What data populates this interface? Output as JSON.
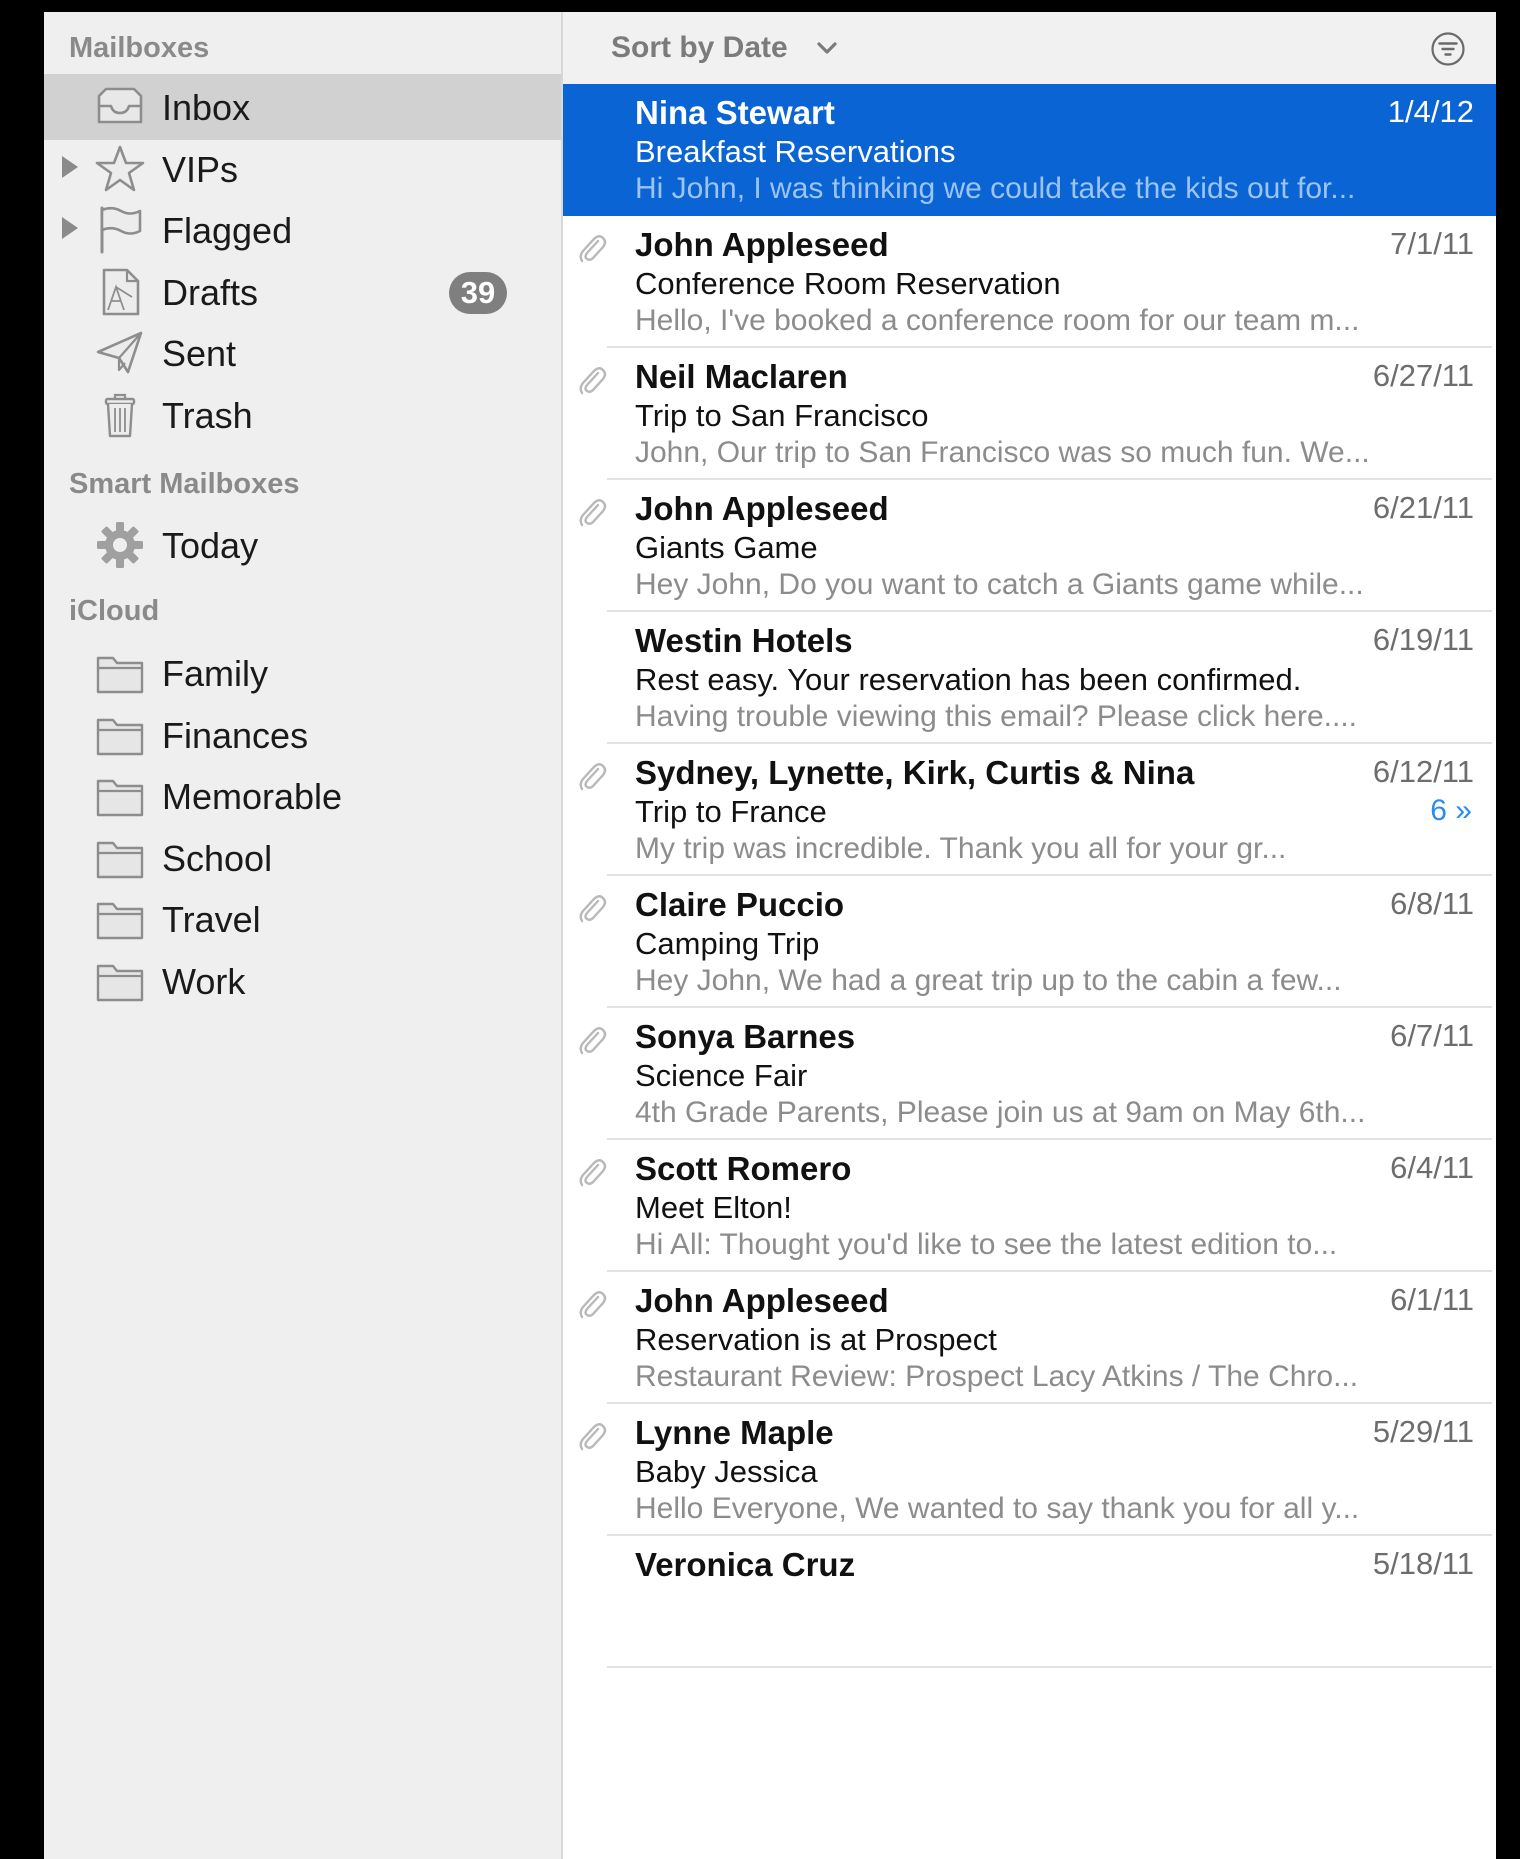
{
  "sidebar": {
    "mailboxes_title": "Mailboxes",
    "mailboxes": [
      {
        "label": "Inbox",
        "icon": "inbox-tray-icon",
        "selected": true
      },
      {
        "label": "VIPs",
        "icon": "star-icon",
        "disclosure": true
      },
      {
        "label": "Flagged",
        "icon": "flag-icon",
        "disclosure": true
      },
      {
        "label": "Drafts",
        "icon": "drafts-page-icon",
        "badge": "39"
      },
      {
        "label": "Sent",
        "icon": "paper-plane-icon"
      },
      {
        "label": "Trash",
        "icon": "trash-can-icon"
      }
    ],
    "smart_title": "Smart Mailboxes",
    "smart": [
      {
        "label": "Today",
        "icon": "gear-icon"
      }
    ],
    "icloud_title": "iCloud",
    "icloud": [
      {
        "label": "Family",
        "icon": "folder-icon"
      },
      {
        "label": "Finances",
        "icon": "folder-icon"
      },
      {
        "label": "Memorable",
        "icon": "folder-icon"
      },
      {
        "label": "School",
        "icon": "folder-icon"
      },
      {
        "label": "Travel",
        "icon": "folder-icon"
      },
      {
        "label": "Work",
        "icon": "folder-icon"
      }
    ]
  },
  "list": {
    "sort_label": "Sort by Date",
    "messages": [
      {
        "sender": "Nina Stewart",
        "date": "1/4/12",
        "subject": "Breakfast Reservations",
        "preview": "Hi John, I was thinking we could take the kids out for...",
        "attachment": false,
        "selected": true
      },
      {
        "sender": "John Appleseed",
        "date": "7/1/11",
        "subject": "Conference Room Reservation",
        "preview": "Hello, I've booked a conference room for our team m...",
        "attachment": true
      },
      {
        "sender": "Neil Maclaren",
        "date": "6/27/11",
        "subject": "Trip to San Francisco",
        "preview": "John, Our trip to San Francisco was so much fun. We...",
        "attachment": true
      },
      {
        "sender": "John Appleseed",
        "date": "6/21/11",
        "subject": "Giants Game",
        "preview": "Hey John, Do you want to catch a Giants game while...",
        "attachment": true
      },
      {
        "sender": "Westin Hotels",
        "date": "6/19/11",
        "subject": "Rest easy. Your reservation has been confirmed.",
        "preview": "Having trouble viewing this email? Please click here....",
        "attachment": false
      },
      {
        "sender": "Sydney, Lynette, Kirk, Curtis & Nina",
        "date": "6/12/11",
        "subject": "Trip to France",
        "preview": "My trip was incredible. Thank you all for your gr...",
        "attachment": true,
        "thread_count": "6 »"
      },
      {
        "sender": "Claire Puccio",
        "date": "6/8/11",
        "subject": "Camping Trip",
        "preview": "Hey John, We had a great trip up to the cabin a few...",
        "attachment": true
      },
      {
        "sender": "Sonya Barnes",
        "date": "6/7/11",
        "subject": "Science Fair",
        "preview": "4th Grade Parents, Please join us at 9am on May 6th...",
        "attachment": true
      },
      {
        "sender": "Scott Romero",
        "date": "6/4/11",
        "subject": "Meet Elton!",
        "preview": "Hi All: Thought you'd like to see the latest edition to...",
        "attachment": true
      },
      {
        "sender": "John Appleseed",
        "date": "6/1/11",
        "subject": "Reservation is at Prospect",
        "preview": "Restaurant Review: Prospect Lacy Atkins / The Chro...",
        "attachment": true
      },
      {
        "sender": "Lynne Maple",
        "date": "5/29/11",
        "subject": "Baby Jessica",
        "preview": "Hello Everyone, We wanted to say thank you for all y...",
        "attachment": true
      },
      {
        "sender": "Veronica Cruz",
        "date": "5/18/11",
        "subject": "",
        "preview": "",
        "attachment": false
      }
    ]
  },
  "colors": {
    "selection_blue": "#0a64d3",
    "sidebar_bg": "#efefef",
    "sidebar_selected": "#d1d1d1",
    "thread_blue": "#2a8cf0"
  }
}
